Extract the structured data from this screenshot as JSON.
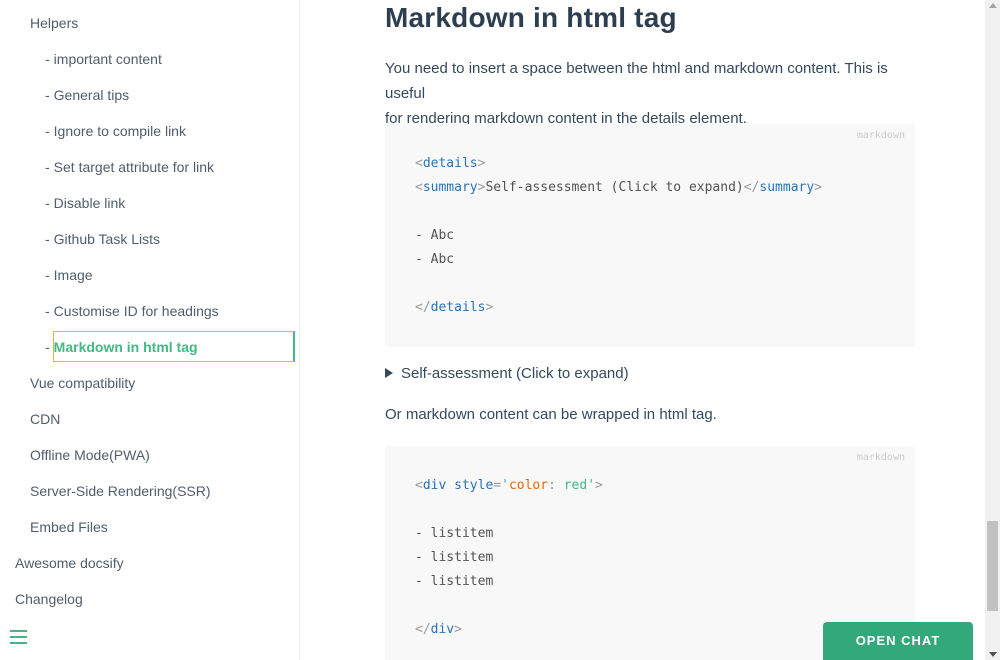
{
  "sidebar": {
    "group_label": "Helpers",
    "sub_items": [
      {
        "label": "important content"
      },
      {
        "label": "General tips"
      },
      {
        "label": "Ignore to compile link"
      },
      {
        "label": "Set target attribute for link"
      },
      {
        "label": "Disable link"
      },
      {
        "label": "Github Task Lists"
      },
      {
        "label": "Image"
      },
      {
        "label": "Customise ID for headings"
      },
      {
        "label": "Markdown in html tag",
        "active": true
      }
    ],
    "level1_items": [
      {
        "label": "Vue compatibility"
      },
      {
        "label": "CDN"
      },
      {
        "label": "Offline Mode(PWA)"
      },
      {
        "label": "Server-Side Rendering(SSR)"
      },
      {
        "label": "Embed Files"
      }
    ],
    "top_items": [
      {
        "label": "Awesome docsify"
      },
      {
        "label": "Changelog"
      }
    ],
    "dash": "-",
    "menu_icon": "hamburger-icon"
  },
  "main": {
    "heading": "Markdown in html tag",
    "para1_line1": "You need to insert a space between the html and markdown content. This is useful",
    "para1_line2": "for rendering markdown content in the details element.",
    "code1": {
      "lang": "markdown",
      "lines": [
        "<details>",
        "<summary>Self-assessment (Click to expand)</summary>",
        "",
        "- Abc",
        "- Abc",
        "",
        "</details>"
      ]
    },
    "details_summary": "Self-assessment (Click to expand)",
    "para2": "Or markdown content can be wrapped in html tag.",
    "code2": {
      "lang": "markdown",
      "lines": [
        "<div style='color: red'>",
        "",
        "- listitem",
        "- listitem",
        "- listitem",
        "",
        "</div>"
      ]
    }
  },
  "chat": {
    "label": "OPEN CHAT"
  },
  "colors": {
    "accent": "#42b983",
    "chat": "#33a87a",
    "text": "#34495e"
  }
}
